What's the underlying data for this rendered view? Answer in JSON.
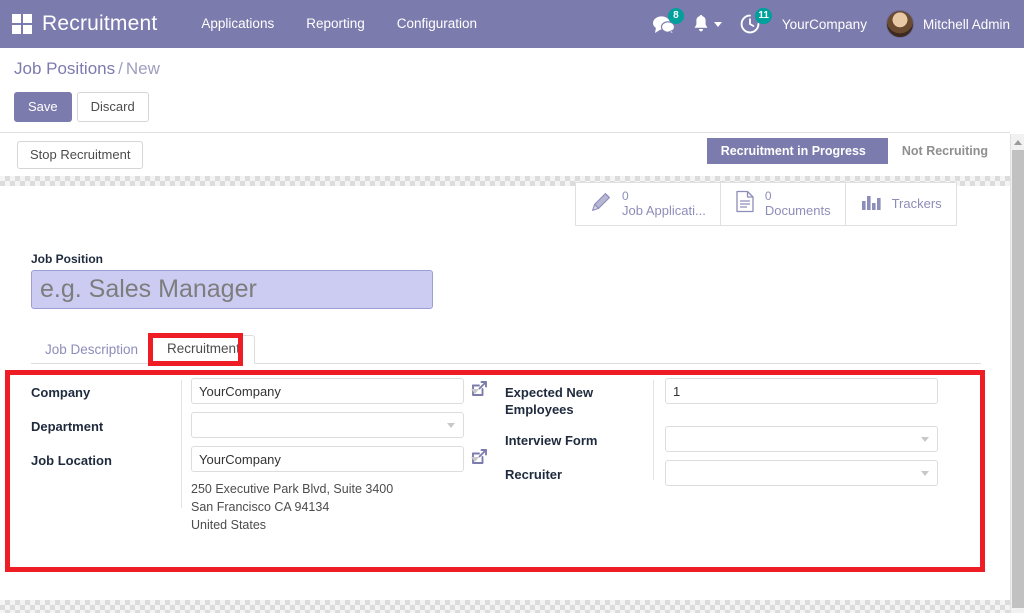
{
  "navbar": {
    "apps_icon": "apps-grid-icon",
    "brand": "Recruitment",
    "menu": [
      {
        "label": "Applications"
      },
      {
        "label": "Reporting"
      },
      {
        "label": "Configuration"
      }
    ],
    "messages_icon": "messages-icon",
    "messages_count": "8",
    "activities_icon": "bell-icon",
    "clock_icon": "clock-icon",
    "clock_count": "11",
    "company": "YourCompany",
    "user": "Mitchell Admin",
    "avatar": "user-avatar"
  },
  "control_panel": {
    "breadcrumb_root": "Job Positions",
    "breadcrumb_sep": "/",
    "breadcrumb_current": "New",
    "save_label": "Save",
    "discard_label": "Discard"
  },
  "statusbar": {
    "stop_recruitment_label": "Stop Recruitment",
    "steps": [
      {
        "label": "Recruitment in Progress",
        "active": true
      },
      {
        "label": "Not Recruiting",
        "active": false
      }
    ]
  },
  "stat_buttons": [
    {
      "icon": "pencil-icon",
      "value": "0",
      "label": "Job Applicati..."
    },
    {
      "icon": "document-icon",
      "value": "0",
      "label": "Documents"
    },
    {
      "icon": "bar-chart-icon",
      "value": "",
      "label": "Trackers"
    }
  ],
  "form": {
    "job_position_label": "Job Position",
    "job_position_value": "",
    "job_position_placeholder": "e.g. Sales Manager",
    "tabs": [
      {
        "label": "Job Description",
        "active": false
      },
      {
        "label": "Recruitment",
        "active": true
      }
    ],
    "left_fields": {
      "company_label": "Company",
      "company_value": "YourCompany",
      "department_label": "Department",
      "department_value": "",
      "job_location_label": "Job Location",
      "job_location_value": "YourCompany",
      "address_line1": "250 Executive Park Blvd, Suite 3400",
      "address_line2": "San Francisco CA 94134",
      "address_line3": "United States"
    },
    "right_fields": {
      "expected_label_line1": "Expected New",
      "expected_label_line2": "Employees",
      "expected_value": "1",
      "interview_form_label": "Interview Form",
      "interview_form_value": "",
      "recruiter_label": "Recruiter",
      "recruiter_value": ""
    }
  },
  "colors": {
    "brand_purple": "#7C7BAD",
    "badge_teal": "#00A09D",
    "annotation_red": "#ee1c25",
    "input_highlight": "#ccccf2"
  },
  "scrollbar": {
    "up_arrow": "scroll-up-arrow"
  }
}
